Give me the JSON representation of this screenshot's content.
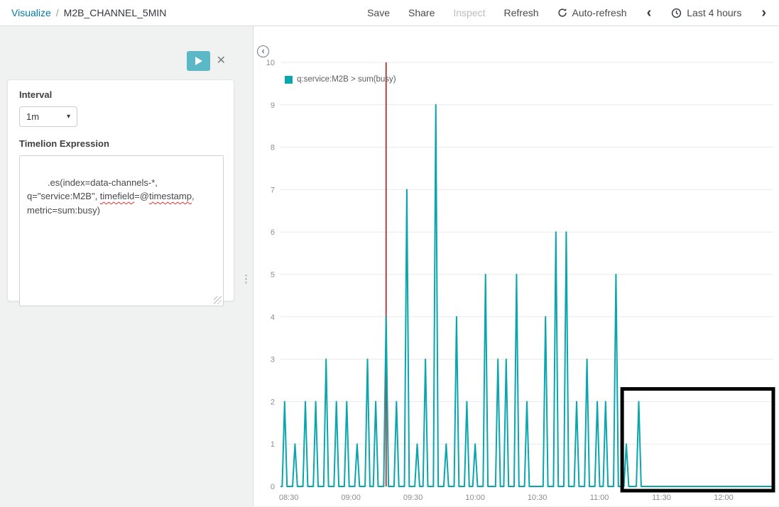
{
  "topbar": {
    "breadcrumb_section": "Visualize",
    "breadcrumb_separator": "/",
    "breadcrumb_title": "M2B_CHANNEL_5MIN",
    "menu": [
      {
        "label": "Save",
        "disabled": false
      },
      {
        "label": "Share",
        "disabled": false
      },
      {
        "label": "Inspect",
        "disabled": true
      },
      {
        "label": "Refresh",
        "disabled": false
      }
    ],
    "auto_refresh_label": "Auto-refresh",
    "time_range_label": "Last 4 hours"
  },
  "icons": {
    "prev_glyph": "‹",
    "next_glyph": "›",
    "close_glyph": "✕",
    "caret_glyph": "▾",
    "resizer_glyph": "⋮",
    "back_glyph": "‹"
  },
  "sidebar": {
    "interval_label": "Interval",
    "interval_value": "1m",
    "expression_label": "Timelion Expression",
    "expression_value": ".es(index=data-channels-*, q=\"service:M2B\", timefield=@timestamp, metric=sum:busy)",
    "expression_parts": [
      {
        "text": ".es(index=data-channels-*,\nq=\"service:M2B\", ",
        "misspelled": false
      },
      {
        "text": "timefield",
        "misspelled": true
      },
      {
        "text": "=@",
        "misspelled": false
      },
      {
        "text": "timestamp",
        "misspelled": true
      },
      {
        "text": ",\nmetric=sum:busy)",
        "misspelled": false
      }
    ]
  },
  "chart_data": {
    "type": "line",
    "series_label": "q:service:M2B > sum(busy)",
    "series_color": "#0aa6ad",
    "ylim": [
      0,
      10
    ],
    "y_ticks": [
      0,
      1,
      2,
      3,
      4,
      5,
      6,
      7,
      8,
      9,
      10
    ],
    "x_ticks": [
      "08:30",
      "09:00",
      "09:30",
      "10:00",
      "10:30",
      "11:00",
      "11:30",
      "12:00"
    ],
    "time_domain": [
      "08:26",
      "12:24"
    ],
    "grid": true,
    "legend_position": "top-left",
    "baseline_value": 0,
    "spikes": [
      [
        "08:28",
        2
      ],
      [
        "08:33",
        1
      ],
      [
        "08:38",
        2
      ],
      [
        "08:43",
        2
      ],
      [
        "08:48",
        3
      ],
      [
        "08:53",
        2
      ],
      [
        "08:58",
        2
      ],
      [
        "09:03",
        1
      ],
      [
        "09:08",
        3
      ],
      [
        "09:12",
        2
      ],
      [
        "09:17",
        4
      ],
      [
        "09:22",
        2
      ],
      [
        "09:27",
        7
      ],
      [
        "09:32",
        1
      ],
      [
        "09:36",
        3
      ],
      [
        "09:41",
        9
      ],
      [
        "09:46",
        1
      ],
      [
        "09:51",
        4
      ],
      [
        "09:56",
        2
      ],
      [
        "10:00",
        1
      ],
      [
        "10:05",
        5
      ],
      [
        "10:11",
        3
      ],
      [
        "10:15",
        3
      ],
      [
        "10:20",
        5
      ],
      [
        "10:25",
        2
      ],
      [
        "10:34",
        4
      ],
      [
        "10:39",
        6
      ],
      [
        "10:44",
        6
      ],
      [
        "10:49",
        2
      ],
      [
        "10:54",
        3
      ],
      [
        "10:59",
        2
      ],
      [
        "11:03",
        2
      ],
      [
        "11:08",
        5
      ],
      [
        "11:13",
        1
      ],
      [
        "11:19",
        2
      ]
    ],
    "marker_line": {
      "t": "09:17",
      "color": "#a94444"
    },
    "annotation_box": {
      "t_start": "11:11",
      "t_end": "12:24",
      "v_top": 2.3,
      "v_bottom": -0.1,
      "color": "#000000"
    }
  }
}
